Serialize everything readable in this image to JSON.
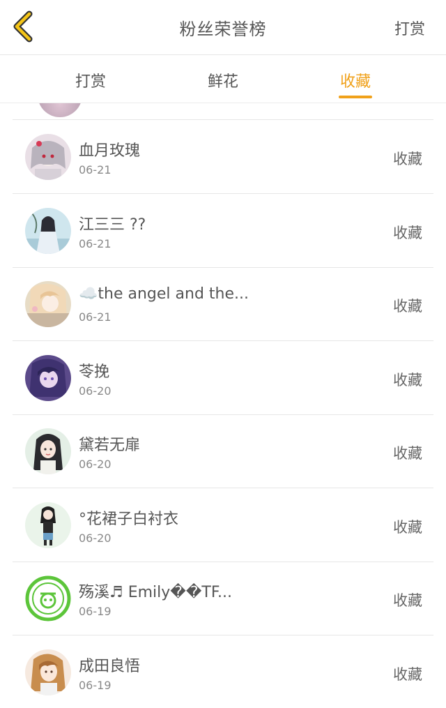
{
  "header": {
    "title": "粉丝荣誉榜",
    "action_label": "打赏",
    "back_icon": "chevron-left-icon",
    "accent_color": "#f0a11a"
  },
  "tabs": [
    {
      "label": "打赏",
      "active": false
    },
    {
      "label": "鲜花",
      "active": false
    },
    {
      "label": "收藏",
      "active": true
    }
  ],
  "list": {
    "items": [
      {
        "name": "血月玫瑰",
        "date": "06-21",
        "action": "收藏"
      },
      {
        "name": "江三三 ??",
        "date": "06-21",
        "action": "收藏"
      },
      {
        "name": "☁️the angel and the...",
        "date": "06-21",
        "action": "收藏"
      },
      {
        "name": "苓挽",
        "date": "06-20",
        "action": "收藏"
      },
      {
        "name": "黛若无扉",
        "date": "06-20",
        "action": "收藏"
      },
      {
        "name": "°花裙子白衬衣",
        "date": "06-20",
        "action": "收藏"
      },
      {
        "name": "殇溪♬ Emily��TF...",
        "date": "06-19",
        "action": "收藏"
      },
      {
        "name": "成田良悟",
        "date": "06-19",
        "action": "收藏"
      }
    ]
  }
}
